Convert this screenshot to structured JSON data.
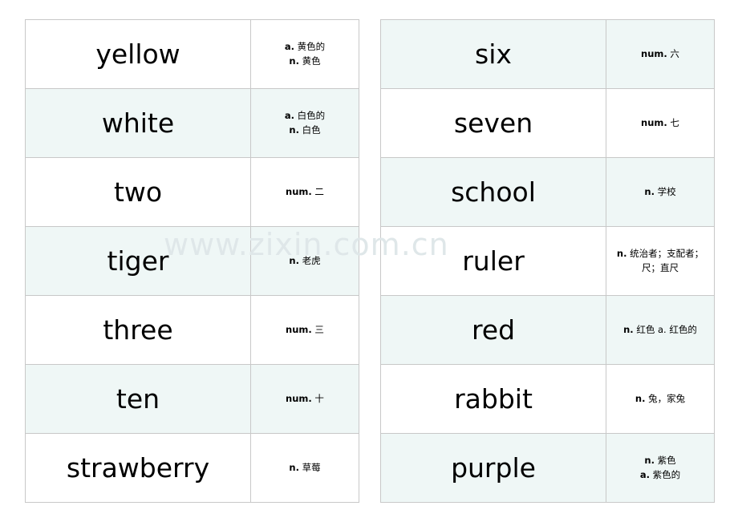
{
  "watermark": "www.zixin.com.cn",
  "columns": [
    {
      "rows": [
        {
          "word": "yellow",
          "defs": [
            "a. 黄色的",
            "n. 黄色"
          ],
          "shaded": false
        },
        {
          "word": "white",
          "defs": [
            "a. 白色的",
            "n. 白色"
          ],
          "shaded": true
        },
        {
          "word": "two",
          "defs": [
            "num. 二"
          ],
          "shaded": false
        },
        {
          "word": "tiger",
          "defs": [
            "n. 老虎"
          ],
          "shaded": true
        },
        {
          "word": "three",
          "defs": [
            "num. 三"
          ],
          "shaded": false
        },
        {
          "word": "ten",
          "defs": [
            "num. 十"
          ],
          "shaded": true
        },
        {
          "word": "strawberry",
          "defs": [
            "n. 草莓"
          ],
          "shaded": false
        }
      ]
    },
    {
      "rows": [
        {
          "word": "six",
          "defs": [
            "num. 六"
          ],
          "shaded": true
        },
        {
          "word": "seven",
          "defs": [
            "num. 七"
          ],
          "shaded": false
        },
        {
          "word": "school",
          "defs": [
            "n. 学校"
          ],
          "shaded": true
        },
        {
          "word": "ruler",
          "defs": [
            "n. 统治者；支配者；",
            "尺；直尺"
          ],
          "shaded": false
        },
        {
          "word": "red",
          "defs": [
            "n. 红色 a. 红色的"
          ],
          "shaded": true
        },
        {
          "word": "rabbit",
          "defs": [
            "n. 兔，家兔"
          ],
          "shaded": false
        },
        {
          "word": "purple",
          "defs": [
            "n. 紫色",
            "a. 紫色的"
          ],
          "shaded": true
        }
      ]
    }
  ]
}
